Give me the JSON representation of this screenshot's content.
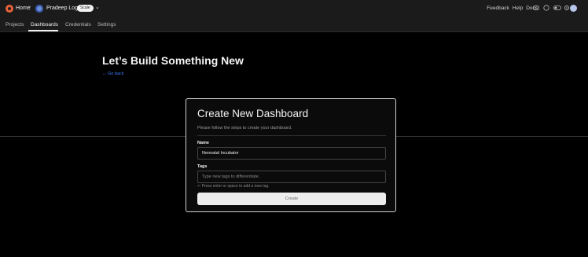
{
  "header": {
    "home_label": "Home",
    "separator": "/",
    "user_name": "Pradeep Logu",
    "plan_badge": "Scale",
    "links": [
      "Feedback",
      "Help",
      "Docs"
    ],
    "icons": [
      "discord-icon",
      "theme-toggle-icon",
      "settings-icon",
      "notification-icon"
    ]
  },
  "nav": {
    "tabs": [
      {
        "label": "Projects",
        "active": false
      },
      {
        "label": "Dashboards",
        "active": true
      },
      {
        "label": "Credentials",
        "active": false
      },
      {
        "label": "Settings",
        "active": false
      }
    ]
  },
  "page": {
    "title": "Let’s Build Something New",
    "go_back": "← Go back"
  },
  "modal": {
    "title": "Create New Dashboard",
    "subtitle": "Please follow the steps to create your dashboard.",
    "name_label": "Name",
    "name_value": "Neonatal Incubator",
    "tags_label": "Tags",
    "tags_placeholder": "Type new tags to differentiate.",
    "tags_hint": "↵ Press enter or space to add a new tag.",
    "create_label": "Create"
  },
  "colors": {
    "background": "#000000",
    "topbar": "#1b1b1b",
    "accent_link": "#3b7bff",
    "logo": "#e8623a"
  }
}
